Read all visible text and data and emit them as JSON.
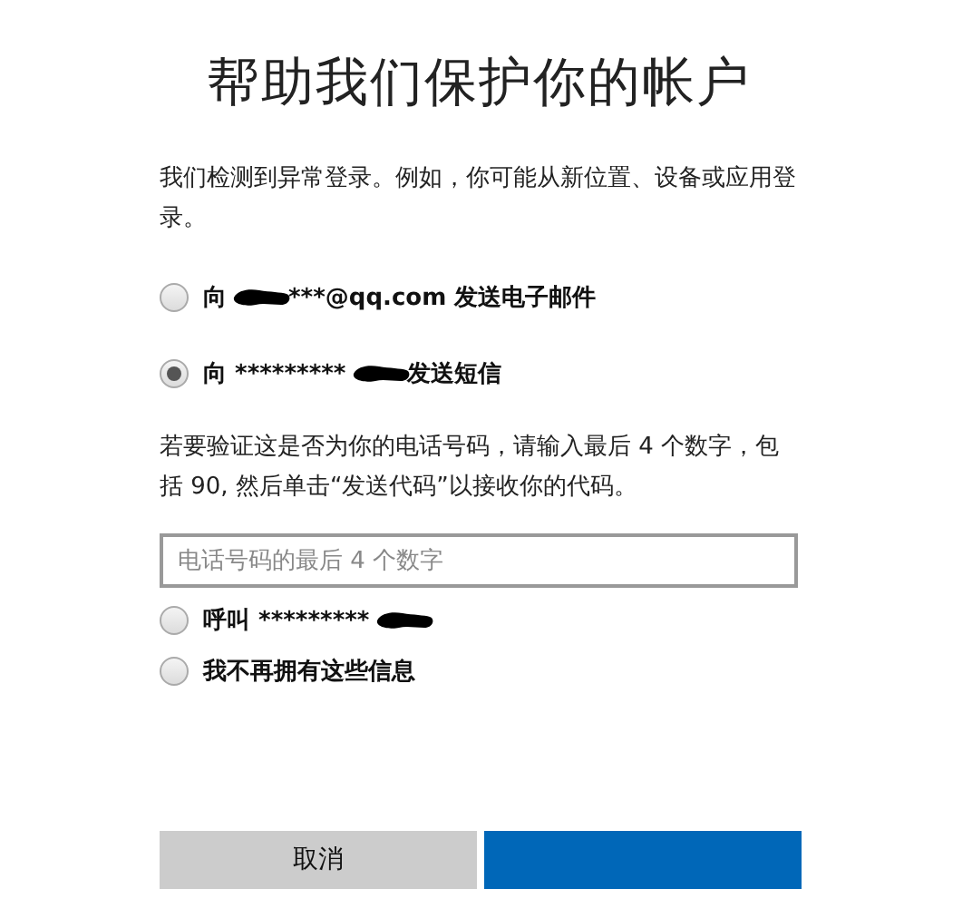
{
  "title": "帮助我们保护你的帐户",
  "intro": "我们检测到异常登录。例如，你可能从新位置、设备或应用登录。",
  "options": [
    {
      "prefix": "向",
      "suffix": "***@qq.com 发送电子邮件",
      "redacted": true,
      "selected": false
    },
    {
      "prefix": "向 *********",
      "suffix": "发送短信",
      "redacted": true,
      "selected": true
    }
  ],
  "verify": {
    "text": "若要验证这是否为你的电话号码，请输入最后 4 个数字，包括 90, 然后单击“发送代码”以接收你的代码。",
    "placeholder": "电话号码的最后 4 个数字"
  },
  "more_options": [
    {
      "prefix": "呼叫 *********",
      "redacted": true,
      "selected": false
    },
    {
      "prefix": "我不再拥有这些信息",
      "redacted": false,
      "selected": false
    }
  ],
  "buttons": [
    {
      "label": "取消",
      "kind": "secondary"
    },
    {
      "kind": "primary"
    }
  ]
}
